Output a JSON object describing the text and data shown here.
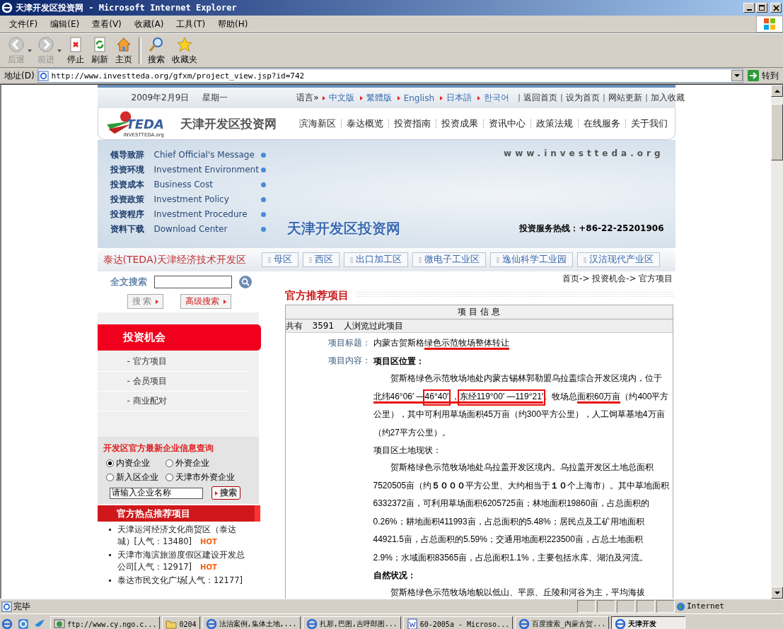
{
  "window": {
    "title": "天津开发区投资网 - Microsoft Internet Explorer"
  },
  "menu": [
    "文件(F)",
    "编辑(E)",
    "查看(V)",
    "收藏(A)",
    "工具(T)",
    "帮助(H)"
  ],
  "toolbar": [
    {
      "label": "后退",
      "kind": "back",
      "disabled": true
    },
    {
      "label": "前进",
      "kind": "forward",
      "disabled": true
    },
    {
      "label": "停止",
      "kind": "stop",
      "disabled": false
    },
    {
      "label": "刷新",
      "kind": "refresh",
      "disabled": false
    },
    {
      "label": "主页",
      "kind": "home",
      "disabled": false
    },
    {
      "label": "搜索",
      "kind": "search",
      "disabled": false
    },
    {
      "label": "收藏夹",
      "kind": "favorites",
      "disabled": false
    }
  ],
  "address": {
    "label": "地址(D)",
    "url": "http://www.investteda.org/gfxm/project_view.jsp?id=742",
    "go": "转到"
  },
  "site": {
    "date": "2009年2月9日",
    "weekday": "星期一",
    "language_label": "语言»",
    "languages": [
      "中文版",
      "繁體版",
      "English",
      "日本語",
      "한국어"
    ],
    "top_links": [
      "返回首页",
      "设为首页",
      "网站更新",
      "加入收藏"
    ],
    "logo": {
      "text": "TEDA",
      "subtext": "INVESTTEDA.org"
    },
    "site_name": "天津开发区投资网",
    "nav": [
      "滨海新区",
      "泰达概览",
      "投资指南",
      "投资成果",
      "资讯中心",
      "政策法规",
      "在线服务",
      "关于我们"
    ],
    "banner": {
      "menu": [
        {
          "cn": "领导致辞",
          "en": "Chief Official's Message"
        },
        {
          "cn": "投资环境",
          "en": "Investment Environment"
        },
        {
          "cn": "投资成本",
          "en": "Business Cost"
        },
        {
          "cn": "投资政策",
          "en": "Investment Policy"
        },
        {
          "cn": "投资程序",
          "en": "Investment Procedure"
        },
        {
          "cn": "资料下载",
          "en": "Download Center"
        }
      ],
      "domain": "www.investteda.org",
      "title": "天津开发区投资网",
      "hotline": "投资服务热线：+86-22-25201906"
    },
    "zone_title": "泰达(TEDA)天津经济技术开发区",
    "zones": [
      "母区",
      "西区",
      "出口加工区",
      "微电子工业区",
      "逸仙科学工业园",
      "汉沽现代产业区"
    ]
  },
  "sidebar": {
    "search_label": "全文搜索",
    "buttons": [
      "搜 索",
      "高级搜索"
    ],
    "section_title": "投资机会",
    "items": [
      "- 官方项目",
      "- 会员项目",
      "- 商业配对"
    ],
    "query": {
      "title": "开发区官方最新企业信息查询",
      "options": [
        {
          "label": "内资企业",
          "selected": true
        },
        {
          "label": "外资企业",
          "selected": false
        },
        {
          "label": "新入区企业",
          "selected": false
        },
        {
          "label": "天津市外资企业",
          "selected": false
        }
      ],
      "value": "请输入企业名称",
      "button": "搜索"
    },
    "hot_title": "官方热点推荐项目",
    "hot_items": [
      {
        "text": "天津运河经济文化商贸区（泰达城）[人气：13480]",
        "badge": "HOT"
      },
      {
        "text": "天津市海滨旅游度假区建设开发总公司[人气：12917]",
        "badge": "HOT"
      },
      {
        "text": "泰达市民文化广场[人气：12177]"
      }
    ]
  },
  "main": {
    "breadcrumb": "首页-> 投资机会-> 官方项目",
    "title": "官方推荐项目",
    "table_header": "项 目 信 息",
    "views": [
      "共有",
      "3591",
      "人浏览过此项目"
    ],
    "title_label": "项目标题：",
    "project_title": [
      {
        "text": "内蒙古贺斯格",
        "underlined": false,
        "boxed": false
      },
      {
        "text": "绿色示范牧场整体转让",
        "underlined": true,
        "boxed": false
      }
    ],
    "content_label": "项目内容：",
    "content": [
      {
        "kind": "heading",
        "bold": true,
        "text": "项目区位置："
      },
      {
        "kind": "paragraph",
        "segments": [
          {
            "text": "贺斯格绿色示范牧场地处内蒙古锡林郭勒盟乌拉盖综合开发区境内，位于",
            "underlined": false,
            "boxed": false
          },
          {
            "text": "北纬46°06′ —",
            "underlined": true,
            "boxed": false
          },
          {
            "text": "46°40′",
            "underlined": true,
            "boxed": true
          },
          {
            "text": " ，",
            "underlined": true,
            "boxed": false
          },
          {
            "text": "东经119°00′ —119°21′",
            "underlined": true,
            "boxed": true
          },
          {
            "text": "。牧场总",
            "underlined": false,
            "boxed": false
          },
          {
            "text": "面积60万亩",
            "underlined": true,
            "boxed": false
          },
          {
            "text": "（约400平方公里），其中可利用草场面积45万亩（约300平方公里），人工饲草基地4万亩（约27平方公里）。",
            "underlined": false,
            "boxed": false
          }
        ]
      },
      {
        "kind": "heading",
        "bold": false,
        "text": "项目区土地现状："
      },
      {
        "kind": "paragraph",
        "segments": [
          {
            "text": "贺斯格绿色示范牧场地处乌拉盖开发区境内。乌拉盖开发区土地总面积7520505亩（约**５０００**平方公里、大约相当于**１０**个上海市）。其中草地面积6332372亩，可利用草场面积6205725亩；林地面积19860亩，占总面积的0.26%；耕地面积411993亩，占总面积的5.48%；居民点及工矿用地面积44921.5亩，占总面积的5.59%；交通用地面积223500亩，占总土地面积2.9%；水域面积83565亩，占总面积1.1%，主要包括水库、湖泊及河流。",
            "underlined": false,
            "boxed": false
          }
        ]
      },
      {
        "kind": "heading",
        "bold": true,
        "text": "自然状况："
      },
      {
        "kind": "paragraph",
        "segments": [
          {
            "text": "贺斯格绿色示范牧场地貌以低山、平原、丘陵和河谷为主，平均海拔",
            "underlined": false,
            "boxed": false
          }
        ]
      }
    ]
  },
  "status_bar": {
    "text": "完毕",
    "zone": "Internet"
  },
  "taskbar": {
    "items": [
      {
        "label": "ftp://www.cy.ngo.c...",
        "kind": "ftp",
        "selected": false
      },
      {
        "label": "0204",
        "kind": "folder",
        "selected": false
      },
      {
        "label": "法治案例,集体土地,...",
        "kind": "ie",
        "selected": false
      },
      {
        "label": "扎那,巴图,吉呼郎图...",
        "kind": "ie",
        "selected": false
      },
      {
        "label": "60-2005a - Microso...",
        "kind": "word",
        "selected": false
      },
      {
        "label": "百度搜索_内蒙古贺...",
        "kind": "ie",
        "selected": false
      },
      {
        "label": "天津开发",
        "kind": "ie",
        "selected": true
      }
    ]
  }
}
